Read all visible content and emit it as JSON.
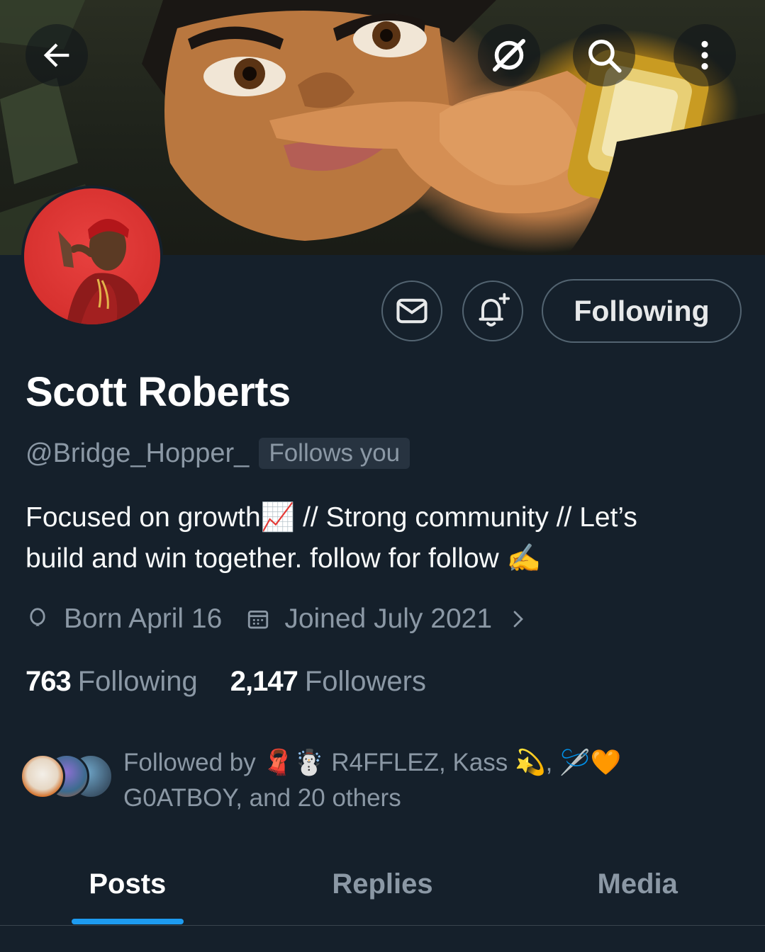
{
  "header": {
    "back_icon": "arrow-left-icon",
    "grok_icon": "slashed-circle-icon",
    "search_icon": "search-icon",
    "more_icon": "more-vertical-icon"
  },
  "actions": {
    "message_icon": "envelope-icon",
    "notify_icon": "bell-plus-icon",
    "follow_label": "Following"
  },
  "profile": {
    "name": "Scott Roberts",
    "handle": "@Bridge_Hopper_",
    "follows_you": "Follows you",
    "bio_line1": "Focused on growth📈 // Strong community // Let’s",
    "bio_line2": "build and win together. follow for follow ✍️",
    "birthday": "Born April 16",
    "joined": "Joined July 2021",
    "following_count": "763",
    "following_label": "Following",
    "followers_count": "2,147",
    "followers_label": "Followers",
    "followed_by_line1": "Followed by 🧣☃️ R4FFLEZ, Kass 💫, 🪡🧡",
    "followed_by_line2": "G0ATBOY, and 20 others"
  },
  "tabs": [
    {
      "label": "Posts"
    },
    {
      "label": "Replies"
    },
    {
      "label": "Media"
    }
  ],
  "colors": {
    "background": "#15202b",
    "accent": "#1d9bf0",
    "secondary_text": "#8b98a5"
  }
}
